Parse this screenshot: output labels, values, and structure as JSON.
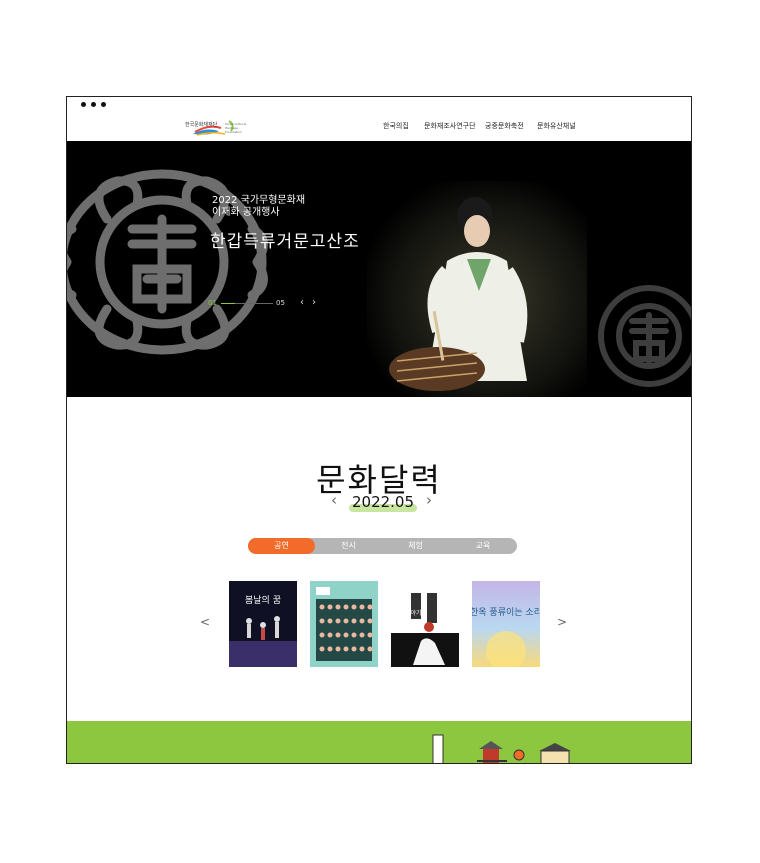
{
  "header": {
    "logo_name": "한국문화재재단",
    "logo_sub": "Korea Cultural Heritage Foundation",
    "nav": [
      "한국의집",
      "문화재조사연구단",
      "궁중문화축전",
      "문화유산채널"
    ]
  },
  "hero": {
    "subtitle_line1": "2022 국가무형문화재",
    "subtitle_line2": "이재화 공개행사",
    "title": "한갑득류거문고산조",
    "pager_current": "01",
    "pager_total": "05",
    "prev_arrow": "‹",
    "next_arrow": "›"
  },
  "calendar": {
    "title": "문화달력",
    "month": "2022.05",
    "prev_arrow": "‹",
    "next_arrow": "›",
    "tabs": [
      "공연",
      "전시",
      "체험",
      "교육"
    ],
    "active_tab": "공연",
    "cards_prev": "<",
    "cards_next": ">",
    "cards": [
      {
        "caption": "봄날의 꿈"
      },
      {
        "caption": ""
      },
      {
        "caption": "이야기"
      },
      {
        "caption": "한옥 풍류이는 소리"
      }
    ]
  },
  "colors": {
    "accent_green": "#8dc63f",
    "active_tab": "#f26b2a",
    "tab_bar": "#b5b5b5",
    "hero_bg": "#000000"
  }
}
